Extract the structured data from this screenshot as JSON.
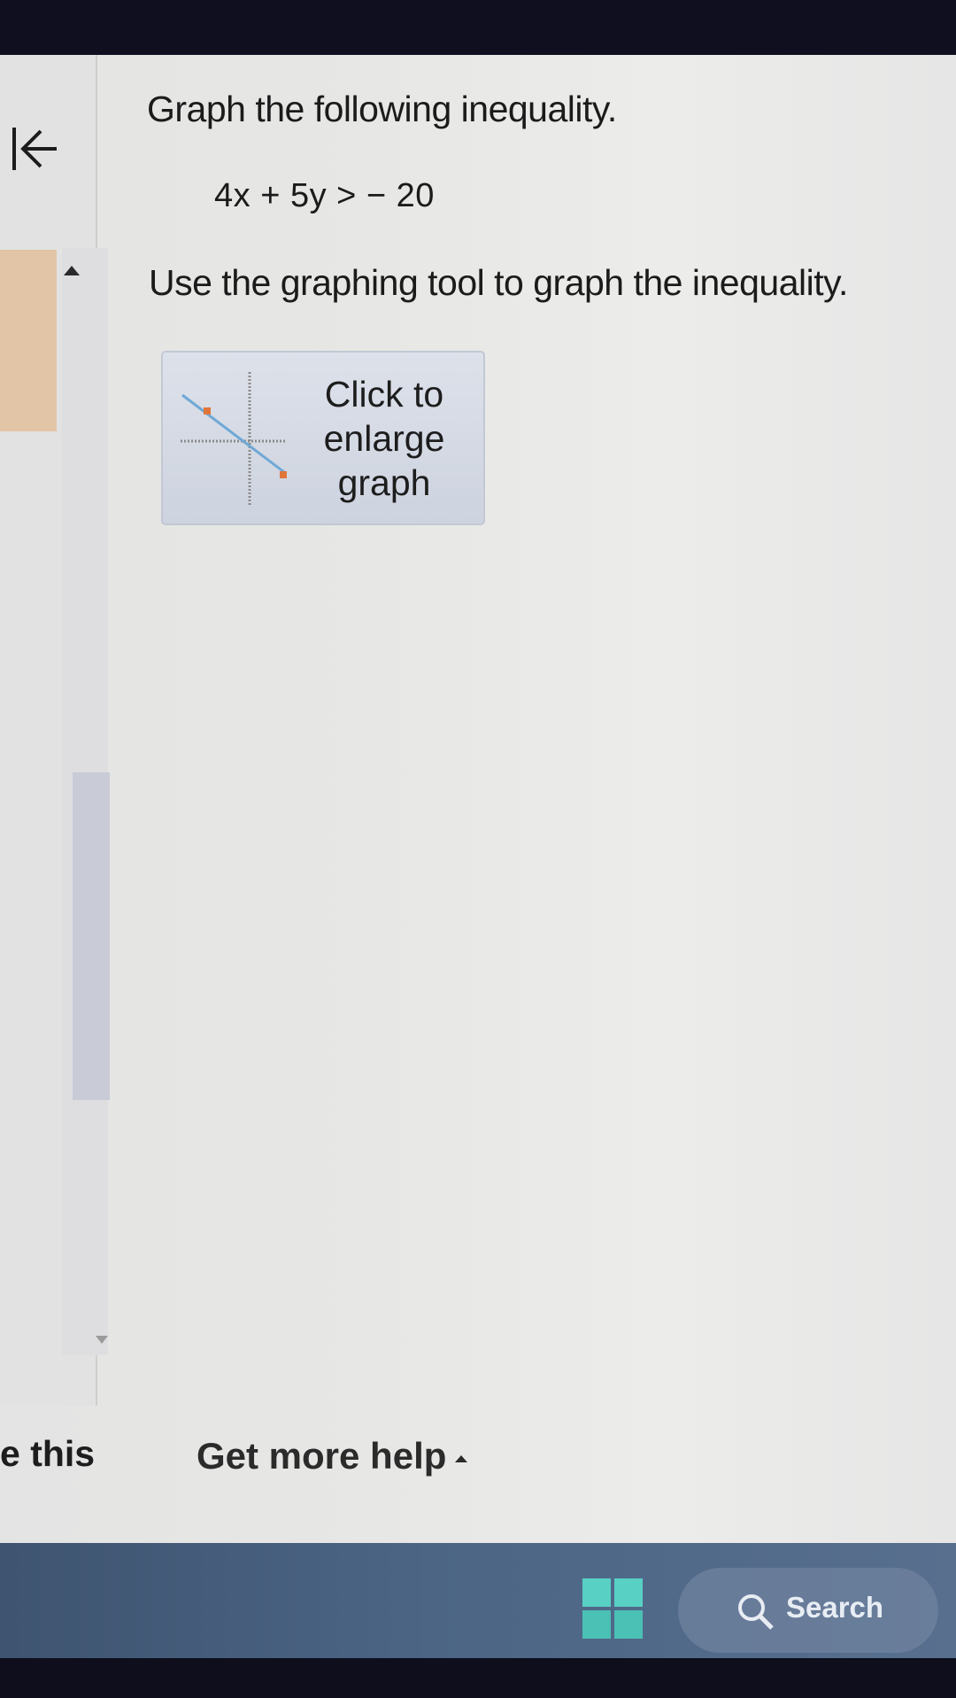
{
  "question": {
    "prompt": "Graph the following inequality.",
    "equation": "4x + 5y >  − 20",
    "instruction": "Use the graphing tool to graph the inequality."
  },
  "graph_button": {
    "label_line1": "Click to",
    "label_line2": "enlarge",
    "label_line3": "graph"
  },
  "footer": {
    "cut_text": "e this",
    "help_link": "Get more help"
  },
  "taskbar": {
    "search_label": "Search"
  },
  "colors": {
    "screen_bg": "#e6e6e6",
    "tan_tab": "#e2c4a6",
    "taskbar": "#4c6585",
    "windows_logo": "#58d0c4"
  },
  "icons": {
    "back": "back-to-start-icon",
    "graph": "graph-thumbnail-icon",
    "start": "windows-start-icon",
    "search": "search-icon"
  }
}
